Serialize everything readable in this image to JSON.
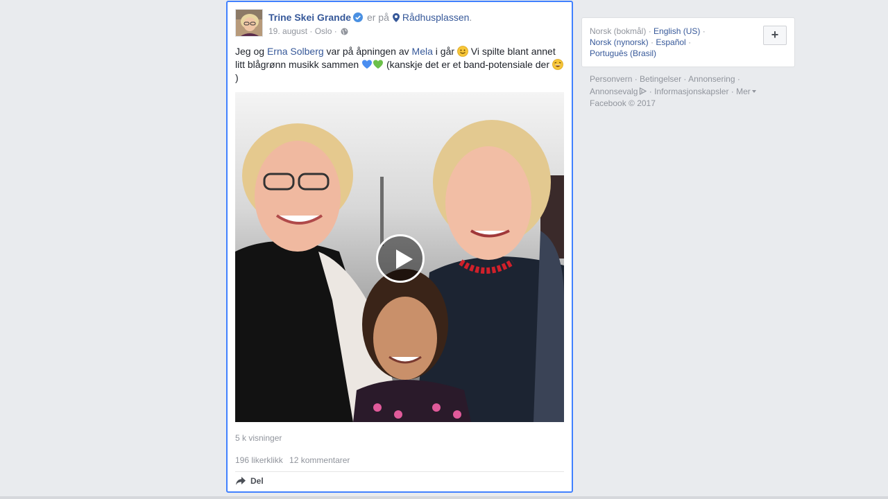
{
  "post": {
    "author": "Trine Skei Grande",
    "verified_icon": "verified-badge-icon",
    "at_text": "er på",
    "place": "Rådhusplassen",
    "place_suffix": ".",
    "date": "19. august",
    "dot1": " · ",
    "location": "Oslo",
    "dot2": " · ",
    "text": {
      "p1": "Jeg og ",
      "mention1": "Erna Solberg",
      "p2": " var på åpningen av ",
      "mention2": "Mela",
      "p3": " i går ",
      "p4": " Vi spilte blant annet litt blågrønn musikk sammen ",
      "p5": " (kanskje det er et band-potensiale der ",
      "p6": ")"
    },
    "views": "5 k visninger",
    "likes": "196 likerklikk",
    "comments": "12 kommentarer",
    "share_label": "Del"
  },
  "languages": {
    "current": "Norsk (bokmål)",
    "items": [
      "English (US)",
      "Norsk (nynorsk)",
      "Español",
      "Português (Brasil)"
    ],
    "sep": " · ",
    "add_label": "+"
  },
  "footer": {
    "links": [
      "Personvern",
      "Betingelser",
      "Annonsering",
      "Annonsevalg",
      "Informasjonskapsler",
      "Mer"
    ],
    "sep": " · ",
    "copyright": "Facebook © 2017"
  },
  "colors": {
    "link": "#365899",
    "muted": "#90949c",
    "focus_border": "#4080ff",
    "background": "#e9ebee"
  }
}
